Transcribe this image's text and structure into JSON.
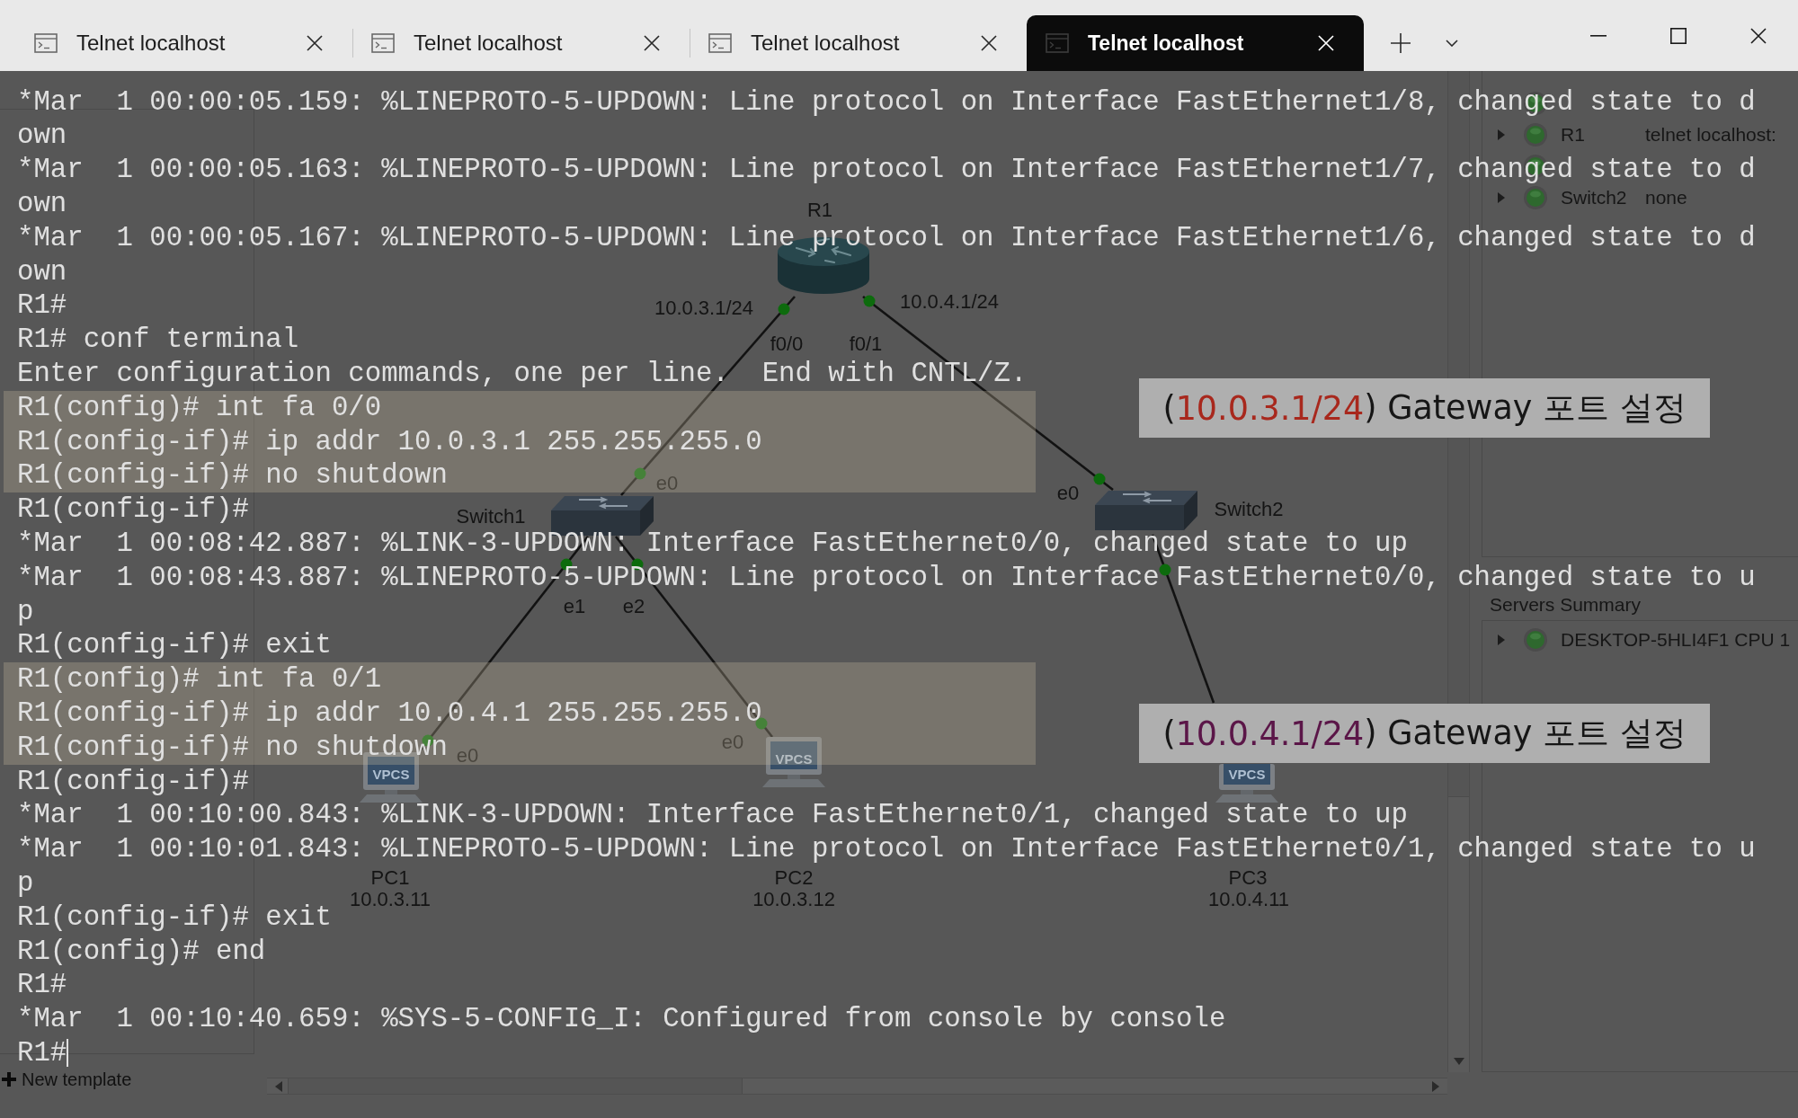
{
  "tabs": [
    {
      "title": "Telnet localhost",
      "selected": false
    },
    {
      "title": "Telnet localhost",
      "selected": false
    },
    {
      "title": "Telnet localhost",
      "selected": false
    },
    {
      "title": "Telnet localhost",
      "selected": true
    }
  ],
  "terminal": {
    "cursor": true,
    "lines": [
      {
        "text": "*Mar  1 00:00:05.159: %LINEPROTO-5-UPDOWN: Line protocol on Interface FastEthernet1/8, changed state to d",
        "highlighted": false
      },
      {
        "text": "own",
        "highlighted": false
      },
      {
        "text": "*Mar  1 00:00:05.163: %LINEPROTO-5-UPDOWN: Line protocol on Interface FastEthernet1/7, changed state to d",
        "highlighted": false
      },
      {
        "text": "own",
        "highlighted": false
      },
      {
        "text": "*Mar  1 00:00:05.167: %LINEPROTO-5-UPDOWN: Line protocol on Interface FastEthernet1/6, changed state to d",
        "highlighted": false
      },
      {
        "text": "own",
        "highlighted": false
      },
      {
        "text": "R1#",
        "highlighted": false
      },
      {
        "text": "R1# conf terminal",
        "highlighted": false
      },
      {
        "text": "Enter configuration commands, one per line.  End with CNTL/Z.",
        "highlighted": false
      },
      {
        "text": "R1(config)# int fa 0/0",
        "highlighted": true
      },
      {
        "text": "R1(config-if)# ip addr 10.0.3.1 255.255.255.0",
        "highlighted": true
      },
      {
        "text": "R1(config-if)# no shutdown",
        "highlighted": true
      },
      {
        "text": "R1(config-if)#",
        "highlighted": false
      },
      {
        "text": "*Mar  1 00:08:42.887: %LINK-3-UPDOWN: Interface FastEthernet0/0, changed state to up",
        "highlighted": false
      },
      {
        "text": "*Mar  1 00:08:43.887: %LINEPROTO-5-UPDOWN: Line protocol on Interface FastEthernet0/0, changed state to u",
        "highlighted": false
      },
      {
        "text": "p",
        "highlighted": false
      },
      {
        "text": "R1(config-if)# exit",
        "highlighted": false
      },
      {
        "text": "R1(config)# int fa 0/1",
        "highlighted": true
      },
      {
        "text": "R1(config-if)# ip addr 10.0.4.1 255.255.255.0",
        "highlighted": true
      },
      {
        "text": "R1(config-if)# no shutdown",
        "highlighted": true
      },
      {
        "text": "R1(config-if)#",
        "highlighted": false
      },
      {
        "text": "*Mar  1 00:10:00.843: %LINK-3-UPDOWN: Interface FastEthernet0/1, changed state to up",
        "highlighted": false
      },
      {
        "text": "*Mar  1 00:10:01.843: %LINEPROTO-5-UPDOWN: Line protocol on Interface FastEthernet0/1, changed state to u",
        "highlighted": false
      },
      {
        "text": "p",
        "highlighted": false
      },
      {
        "text": "R1(config-if)# exit",
        "highlighted": false
      },
      {
        "text": "R1(config)# end",
        "highlighted": false
      },
      {
        "text": "R1#",
        "highlighted": false
      },
      {
        "text": "*Mar  1 00:10:40.659: %SYS-5-CONFIG_I: Configured from console by console",
        "highlighted": false
      },
      {
        "text": "R1#",
        "highlighted": false
      }
    ]
  },
  "annotations": [
    {
      "prefix": "(",
      "address": "10.0.3.1/24",
      "suffix": ") Gateway 포트 설정",
      "color": "#a8281d"
    },
    {
      "prefix": "(",
      "address": "10.0.4.1/24",
      "suffix": ") Gateway 포트 설정",
      "color": "#5b1648"
    }
  ],
  "gns3": {
    "topology": {
      "nodes": [
        {
          "kind": "router",
          "name": "R1"
        },
        {
          "kind": "switch",
          "name": "Switch1"
        },
        {
          "kind": "switch",
          "name": "Switch2"
        },
        {
          "kind": "vpcs",
          "name": "PC1",
          "screen": "VPCS",
          "address": "10.0.3.11"
        },
        {
          "kind": "vpcs",
          "name": "PC2",
          "screen": "VPCS",
          "address": "10.0.3.12"
        },
        {
          "kind": "vpcs",
          "name": "PC3",
          "screen": "VPCS",
          "address": "10.0.4.11"
        }
      ],
      "links": [
        {
          "up": true,
          "a_address": "10.0.3.1/24",
          "a_port": "f0/0",
          "b_port": "e0"
        },
        {
          "up": true,
          "a_address": "10.0.4.1/24",
          "a_port": "f0/1",
          "b_port": "e0"
        },
        {
          "up": true,
          "a_port": "e1",
          "b_port": "e0"
        },
        {
          "up": true,
          "a_port": "e2",
          "b_port": "e0"
        },
        {
          "up": true
        }
      ]
    },
    "devices": [
      {
        "running": true
      },
      {
        "name": "R1",
        "console": "telnet localhost:",
        "expanded": false,
        "running": true
      },
      {
        "running": true
      },
      {
        "name": "Switch2",
        "console": "none",
        "expanded": false,
        "running": true
      }
    ],
    "servers_title": "Servers Summary",
    "servers": [
      {
        "name": "DESKTOP-5HLI4F1 CPU 1",
        "expanded": false,
        "running": true
      }
    ],
    "new_template": "New template"
  }
}
